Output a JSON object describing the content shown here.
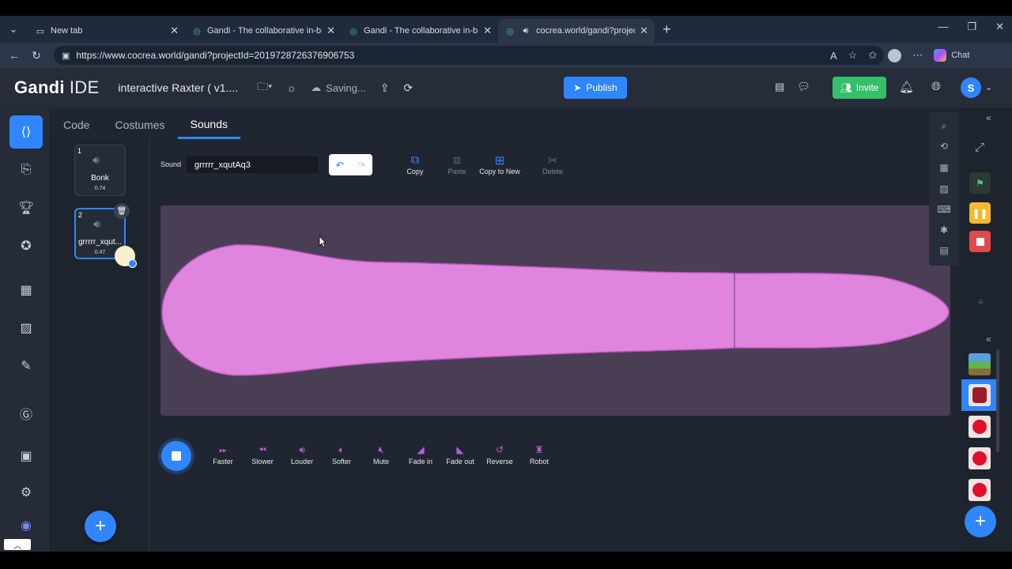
{
  "browser": {
    "tabs": [
      {
        "label": "New tab",
        "icon": "page-icon",
        "active": false
      },
      {
        "label": "Gandi - The collaborative in-brows",
        "icon": "gandi-icon",
        "active": false
      },
      {
        "label": "Gandi - The collaborative in-brows",
        "icon": "gandi-icon",
        "active": false
      },
      {
        "label": "cocrea.world/gandi?projectId",
        "icon": "gandi-icon",
        "active": true
      }
    ],
    "url": "https://www.cocrea.world/gandi?projectId=2019728726376906753",
    "chat_label": "Chat"
  },
  "app": {
    "logo": "Gandi",
    "logo_suffix": "IDE",
    "project_title": "interactive Raxter ( v1....",
    "saving_label": "Saving...",
    "publish_label": "Publish",
    "invite_label": "Invite",
    "user_initial": "S",
    "accent": "#2f86ff",
    "invite_color": "#33c06a"
  },
  "editor_tabs": [
    "Code",
    "Costumes",
    "Sounds"
  ],
  "active_editor_tab": "Sounds",
  "sounds": [
    {
      "index": "1",
      "name": "Bonk",
      "duration": "0.74"
    },
    {
      "index": "2",
      "name": "grrrrr_xqut...",
      "duration": "0.47"
    }
  ],
  "sound_editor": {
    "label": "Sound",
    "name_value": "grrrrr_xqutAq3",
    "tools": [
      {
        "label": "Copy",
        "enabled": true
      },
      {
        "label": "Paste",
        "enabled": false
      },
      {
        "label": "Copy to New",
        "enabled": true
      },
      {
        "label": "Delete",
        "enabled": false
      }
    ],
    "waveform_color": "#df85de",
    "effects": [
      {
        "label": "Faster",
        "icon": "faster-icon"
      },
      {
        "label": "Slower",
        "icon": "slower-icon"
      },
      {
        "label": "Louder",
        "icon": "louder-icon"
      },
      {
        "label": "Softer",
        "icon": "softer-icon"
      },
      {
        "label": "Mute",
        "icon": "mute-icon"
      },
      {
        "label": "Fade in",
        "icon": "fade-in-icon"
      },
      {
        "label": "Fade out",
        "icon": "fade-out-icon"
      },
      {
        "label": "Reverse",
        "icon": "reverse-icon"
      },
      {
        "label": "Robot",
        "icon": "robot-icon"
      }
    ]
  }
}
